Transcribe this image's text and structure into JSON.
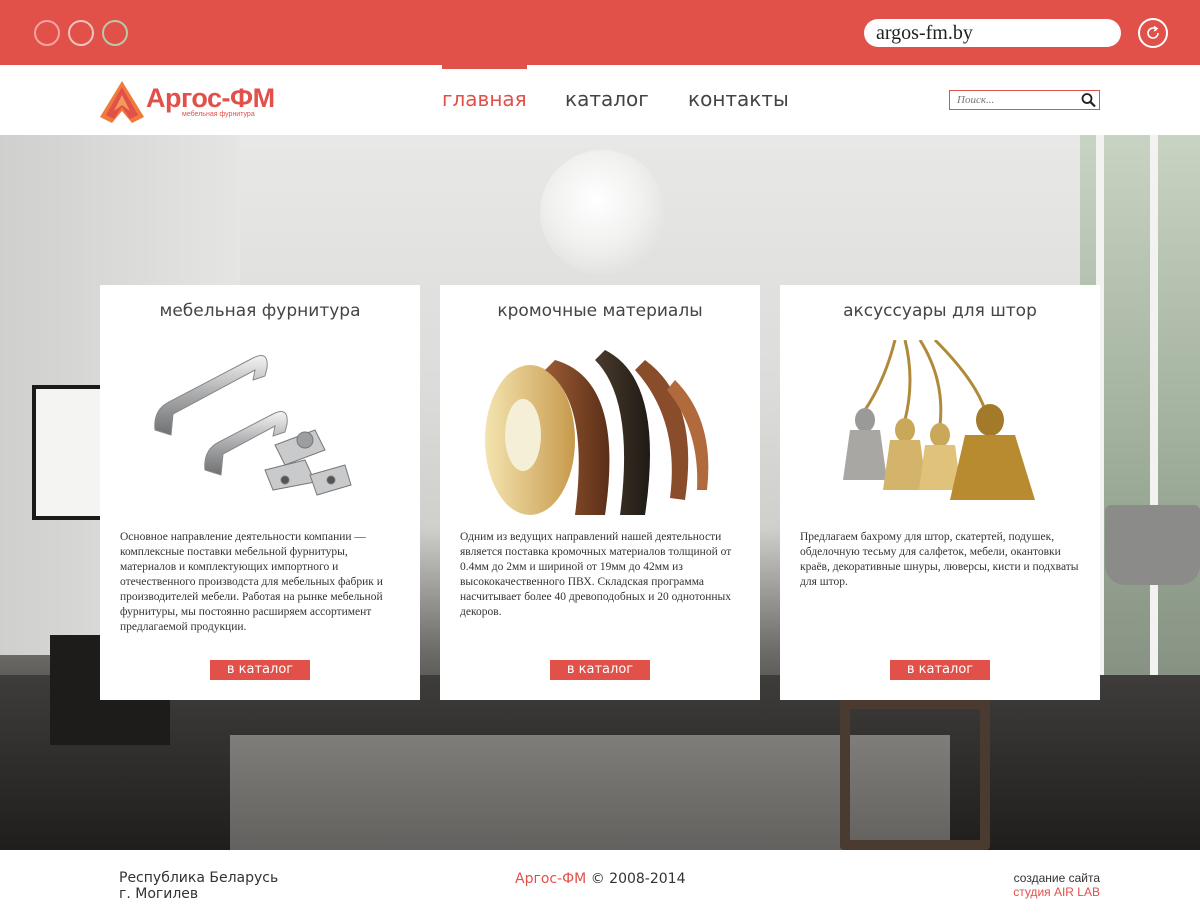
{
  "browser": {
    "url": "argos-fm.by"
  },
  "header": {
    "logo_text": "Аргос-ФМ",
    "logo_subtitle": "мебельная фурнитура",
    "nav": [
      {
        "label": "главная",
        "active": true
      },
      {
        "label": "каталог",
        "active": false
      },
      {
        "label": "контакты",
        "active": false
      }
    ],
    "search_placeholder": "Поиск..."
  },
  "cards": [
    {
      "title": "мебельная фурнитура",
      "image": "furniture-handles-and-hinges",
      "text": "Основное направление деятельности компании — комплексные поставки мебельной фурнитуры, материалов и комплектующих импортного и отечественного производста для мебельных фабрик и производителей мебели. Работая на рынке мебельной фурнитуры, мы постоянно расширяем ассортимент предлагаемой продукции.",
      "button": "в каталог"
    },
    {
      "title": "кромочные материалы",
      "image": "edge-banding-rolls",
      "text": "Одним из ведущих направлений нашей деятельности является поставка кромочных материалов толщиной от 0.4мм до 2мм и шириной от 19мм до 42мм из высококачественного ПВХ. Складская программа насчитывает более 40 древоподобных и 20 однотонных декоров.",
      "button": "в каталог"
    },
    {
      "title": "аксуссуары для штор",
      "image": "curtain-tassels",
      "text": "Предлагаем бахрому для штор, скатертей, подушек, обделочную тесьму для салфеток, мебели, окантовки краёв, декоративные шнуры, люверсы, кисти и подхваты для штор.",
      "button": "в каталог"
    }
  ],
  "footer": {
    "address_line1": "Республика Беларусь",
    "address_line2": "г. Могилев",
    "copyright_brand": "Аргос-ФМ",
    "copyright_rest": " © 2008-2014",
    "made_by_label": "создание сайта",
    "made_by_studio": "студия AIR LAB"
  },
  "colors": {
    "accent": "#e2504a",
    "text": "#333333"
  }
}
